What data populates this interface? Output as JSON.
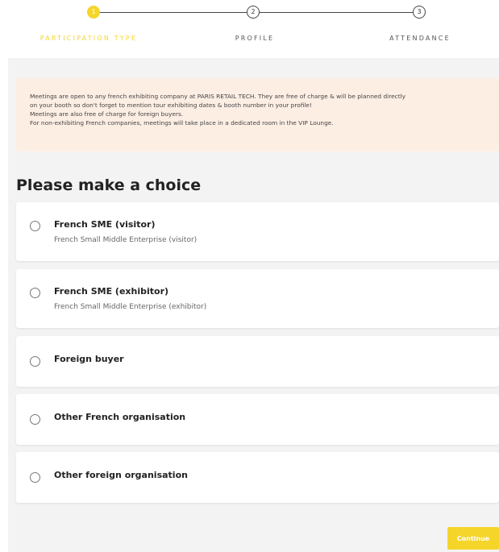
{
  "stepper": {
    "steps": [
      {
        "number": "1",
        "label": "PARTICIPATION TYPE",
        "state": "active"
      },
      {
        "number": "2",
        "label": "PROFILE",
        "state": "todo"
      },
      {
        "number": "3",
        "label": "ATTENDANCE",
        "state": "todo"
      }
    ]
  },
  "info": {
    "lines": [
      "Meetings are open to any french exhibiting company at PARIS RETAIL TECH. They are free of charge & will be planned directly",
      "on your booth so don't forget to mention tour exhibiting dates & booth number in your profile!",
      "Meetings are also free of charge for foreign buyers.",
      "For non-exhibiting French companies, meetings will take place in a dedicated room in the VIP Lounge."
    ]
  },
  "heading": "Please make a choice",
  "options": [
    {
      "title": "French SME (visitor)",
      "subtitle": "French Small Middle Enterprise (visitor)",
      "selected": false
    },
    {
      "title": "French SME (exhibitor)",
      "subtitle": "French Small Middle Enterprise (exhibitor)",
      "selected": false
    },
    {
      "title": "Foreign buyer",
      "subtitle": "",
      "selected": false
    },
    {
      "title": "Other French organisation",
      "subtitle": "",
      "selected": false
    },
    {
      "title": "Other foreign organisation",
      "subtitle": "",
      "selected": false
    }
  ],
  "continue_label": "Continue",
  "colors": {
    "accent": "#f5d52a",
    "info_bg": "#fdeee4",
    "page_bg": "#f3f3f3"
  }
}
